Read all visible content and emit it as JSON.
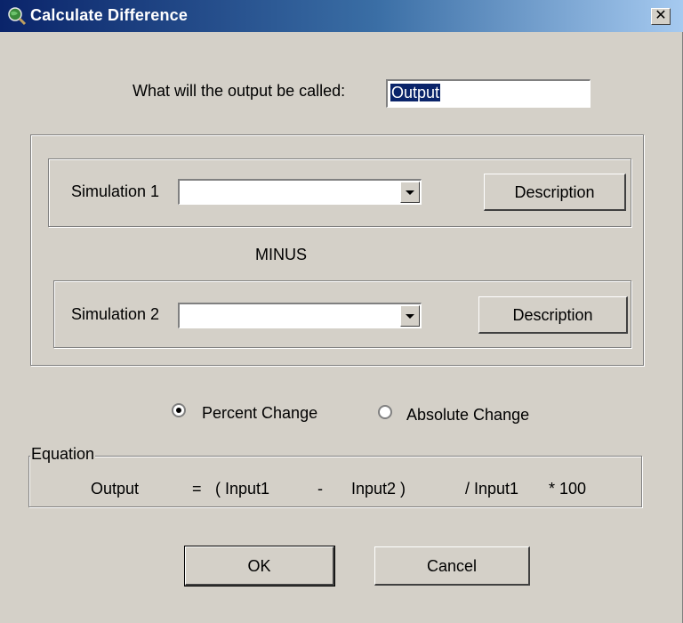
{
  "window": {
    "title": "Calculate Difference",
    "close_label": "✕",
    "icon": "globe-magnifier-icon"
  },
  "output": {
    "label": "What will the output be called:",
    "value": "Output"
  },
  "simulation1": {
    "label": "Simulation 1",
    "value": "",
    "description_button": "Description"
  },
  "operator_label": "MINUS",
  "simulation2": {
    "label": "Simulation 2",
    "value": "",
    "description_button": "Description"
  },
  "change_type": {
    "options": [
      {
        "label": "Percent Change",
        "selected": true
      },
      {
        "label": "Absolute Change",
        "selected": false
      }
    ]
  },
  "equation": {
    "legend": "Equation",
    "lhs": "Output",
    "equals": "=",
    "open": "( Input1",
    "minus": "-",
    "close": "Input2 )",
    "divide": "/ Input1",
    "multiply": "* 100"
  },
  "buttons": {
    "ok": "OK",
    "cancel": "Cancel"
  },
  "colors": {
    "titlebar_start": "#0a246a",
    "face": "#d4d0c8"
  }
}
